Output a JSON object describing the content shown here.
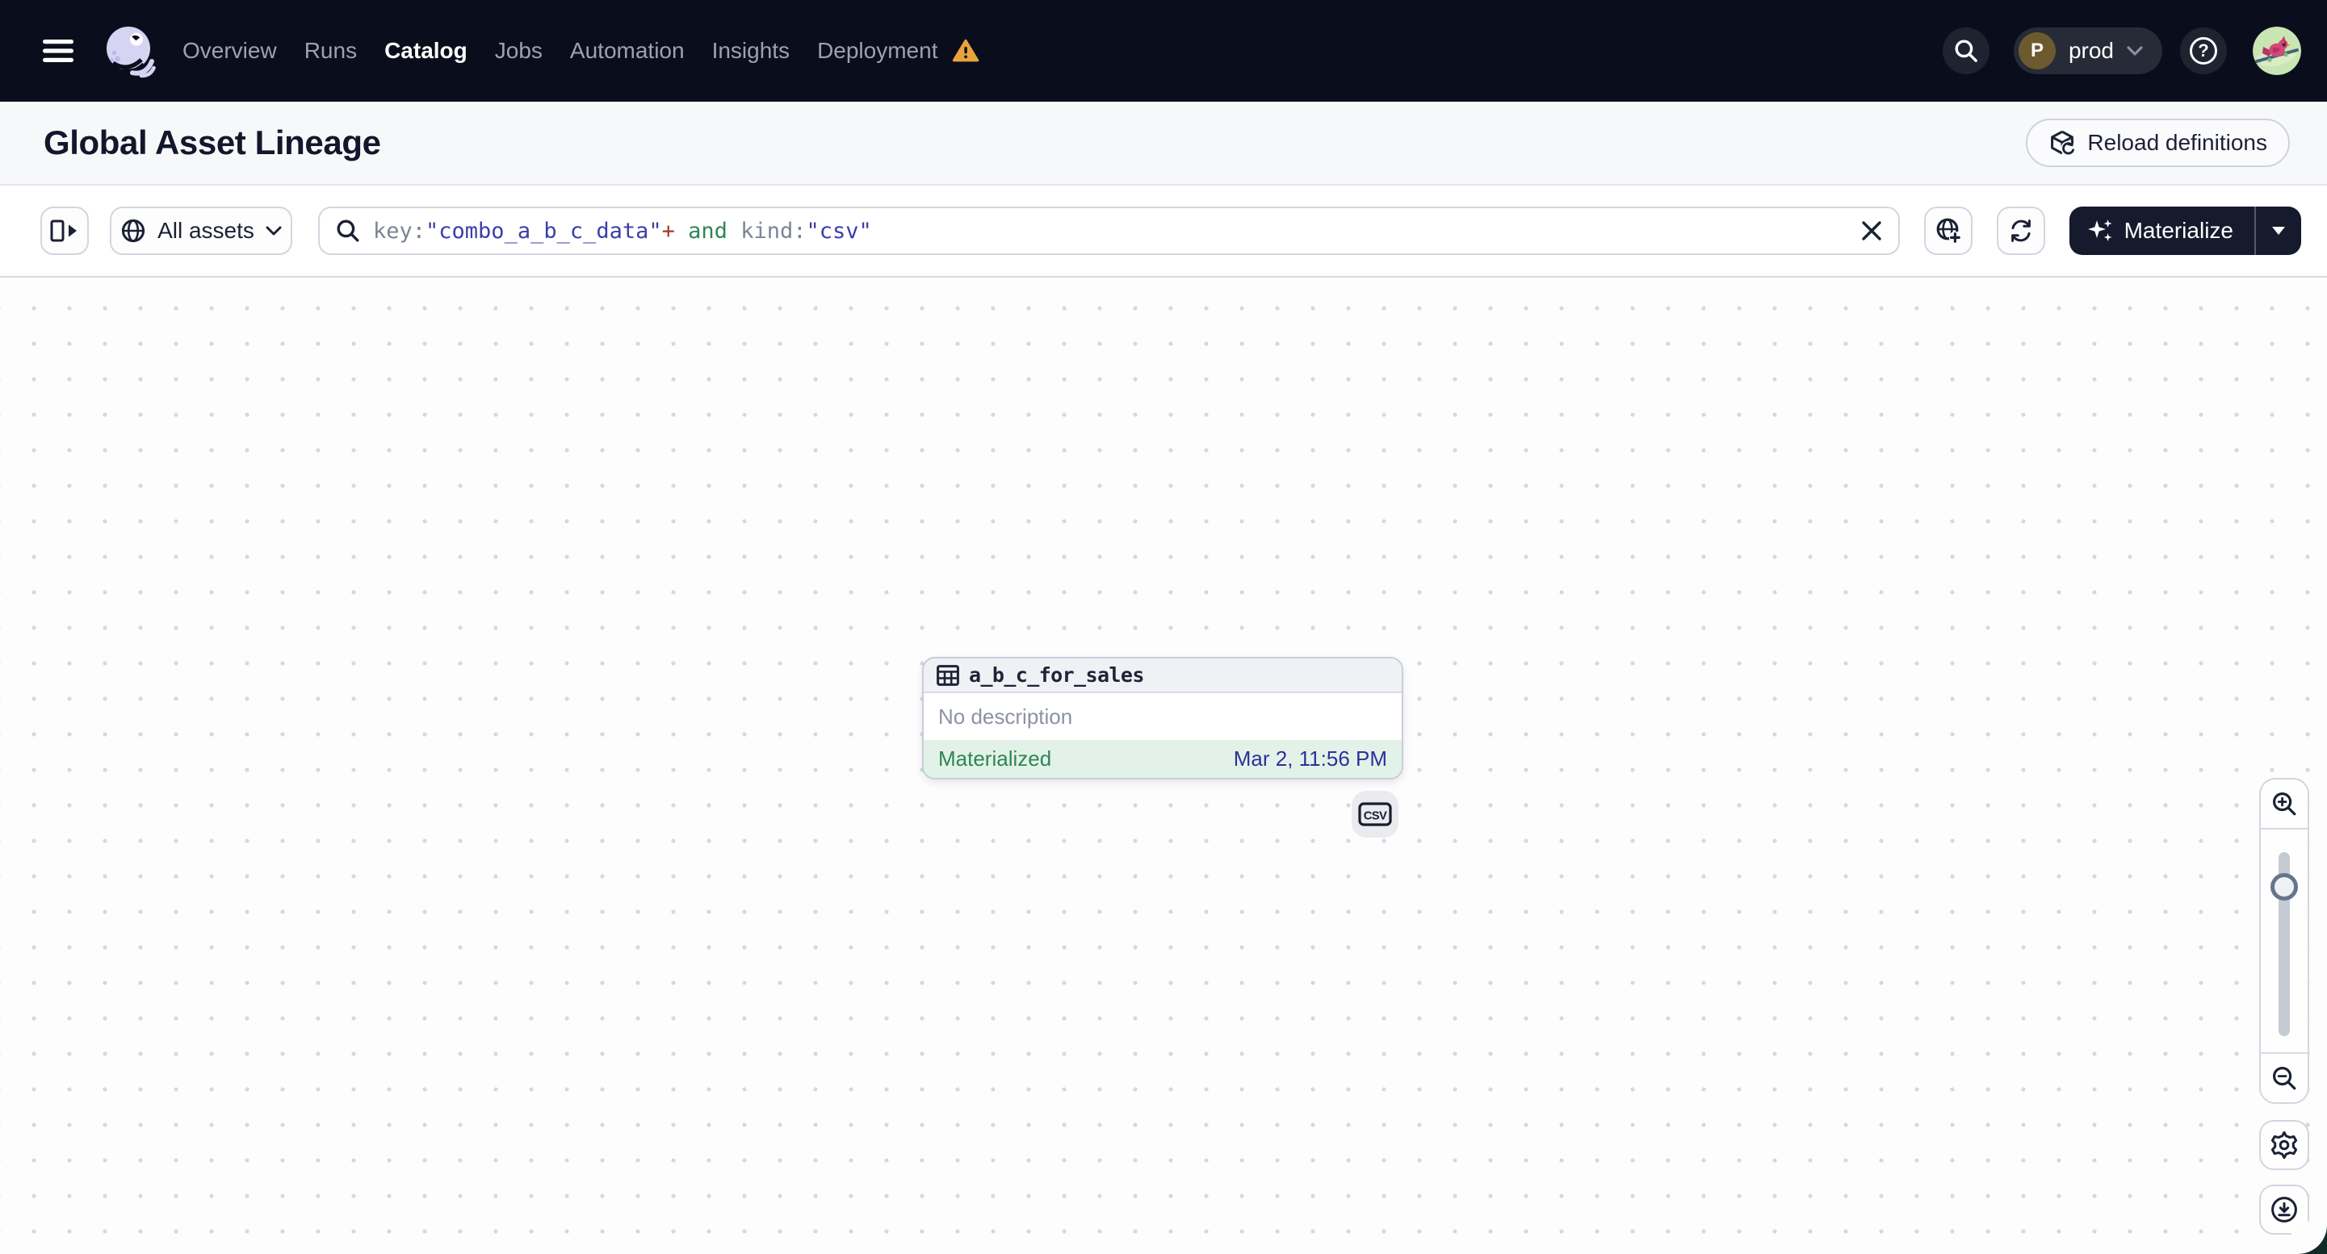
{
  "nav": {
    "items": [
      {
        "label": "Overview",
        "active": false
      },
      {
        "label": "Runs",
        "active": false
      },
      {
        "label": "Catalog",
        "active": true
      },
      {
        "label": "Jobs",
        "active": false
      },
      {
        "label": "Automation",
        "active": false
      },
      {
        "label": "Insights",
        "active": false
      },
      {
        "label": "Deployment",
        "active": false,
        "warning": true
      }
    ],
    "deployment_switcher": {
      "initial": "P",
      "label": "prod"
    },
    "help_label": "?"
  },
  "header": {
    "title": "Global Asset Lineage",
    "reload_button": "Reload definitions"
  },
  "toolbar": {
    "scope_button": "All assets",
    "search": {
      "segments": [
        {
          "text": "key:",
          "kind": "field"
        },
        {
          "text": "\"combo_a_b_c_data\"",
          "kind": "string"
        },
        {
          "text": "+",
          "kind": "operator"
        },
        {
          "text": " and ",
          "kind": "boolean"
        },
        {
          "text": "kind:",
          "kind": "field"
        },
        {
          "text": "\"csv\"",
          "kind": "string"
        }
      ]
    },
    "materialize_button": "Materialize"
  },
  "graph": {
    "node": {
      "name": "a_b_c_for_sales",
      "description": "No description",
      "status": "Materialized",
      "last_materialization": "Mar 2, 11:56 PM",
      "kind_badge": "CSV"
    }
  },
  "icons": {
    "menu": "hamburger",
    "warning": "amber-triangle-exclamation",
    "search": "magnifier",
    "chevron": "chevron-down",
    "reload": "cube-refresh",
    "panel_toggle": "open-right-panel",
    "scope": "globe",
    "clear": "x",
    "globe_plus": "globe-plus",
    "refresh": "circular-arrows",
    "materialize": "sparkles",
    "asset": "table-grid",
    "zoom_in": "magnifier-plus",
    "zoom_out": "magnifier-minus",
    "settings": "gear",
    "download": "download-circle"
  },
  "colors": {
    "navbar_bg": "#0A0E1C",
    "dark_button": "#151B2D",
    "materialized_bg": "#E3F2E8",
    "materialized_text": "#2D8655",
    "timestamp_text": "#2E309B",
    "query_string": "#3B3EA8",
    "query_operator": "#A03B32",
    "query_boolean": "#2E8757",
    "query_field": "#7C8494",
    "warning": "#E9A33C"
  }
}
